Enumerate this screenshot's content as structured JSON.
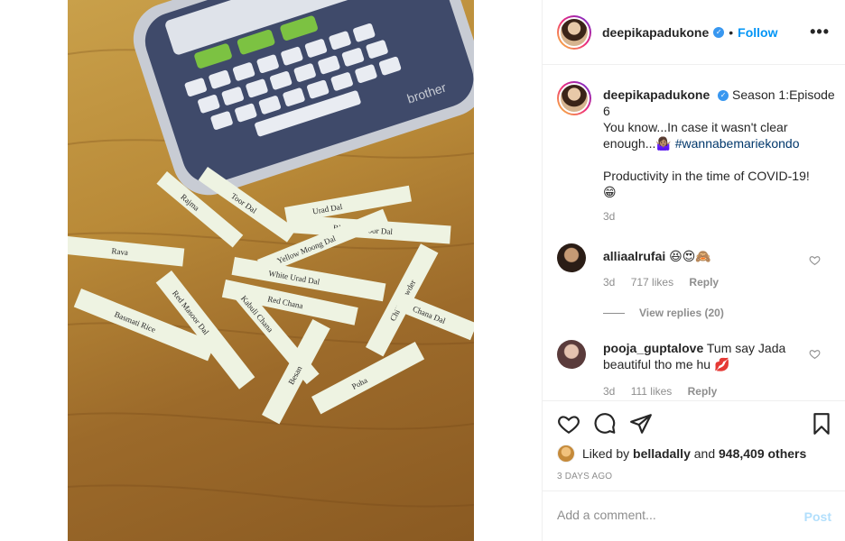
{
  "post": {
    "image_alt": "Label maker with printed pantry labels on a wooden table",
    "label_maker_brand": "brother",
    "label_maker_keys": [
      "Font",
      "Caps",
      "Enter"
    ],
    "labels": [
      "Rava",
      "Toor Dal",
      "Rajma",
      "Urad Dal",
      "Black Masoor Dal",
      "Yellow Moong Dal",
      "White Urad Dal",
      "Red Chana",
      "Kabuli Chana",
      "Chilli Powder",
      "Chana Dal",
      "Basmati Rice",
      "Red Masoor Dal",
      "Besan",
      "Poha"
    ]
  },
  "header": {
    "username": "deepikapadukone",
    "separator": "•",
    "follow_label": "Follow",
    "more_label": "•••"
  },
  "caption": {
    "username": "deepikapadukone",
    "text_line1": "Season 1:Episode 6",
    "text_line2": "You know...In case it wasn't clear enough...🤷🏽‍♀️",
    "hashtag": "#wannabemariekondo",
    "text_line3": "Productivity in the time of COVID-19!",
    "emoji": "😁",
    "time": "3d"
  },
  "comments": [
    {
      "username": "alliaalrufai",
      "text": "😆😍🙈",
      "time": "3d",
      "likes": "717 likes",
      "reply": "Reply",
      "view_replies": "View replies (20)"
    },
    {
      "username": "pooja_guptalove",
      "text": "Tum say Jada beautiful tho me hu 💋",
      "time": "3d",
      "likes": "111 likes",
      "reply": "Reply"
    }
  ],
  "actions": {
    "liked_by_prefix": "Liked by",
    "liked_by_user": "belladally",
    "liked_by_and": "and",
    "likes_count": "948,409 others",
    "time_ago": "3 DAYS AGO"
  },
  "composer": {
    "placeholder": "Add a comment...",
    "post_label": "Post"
  }
}
